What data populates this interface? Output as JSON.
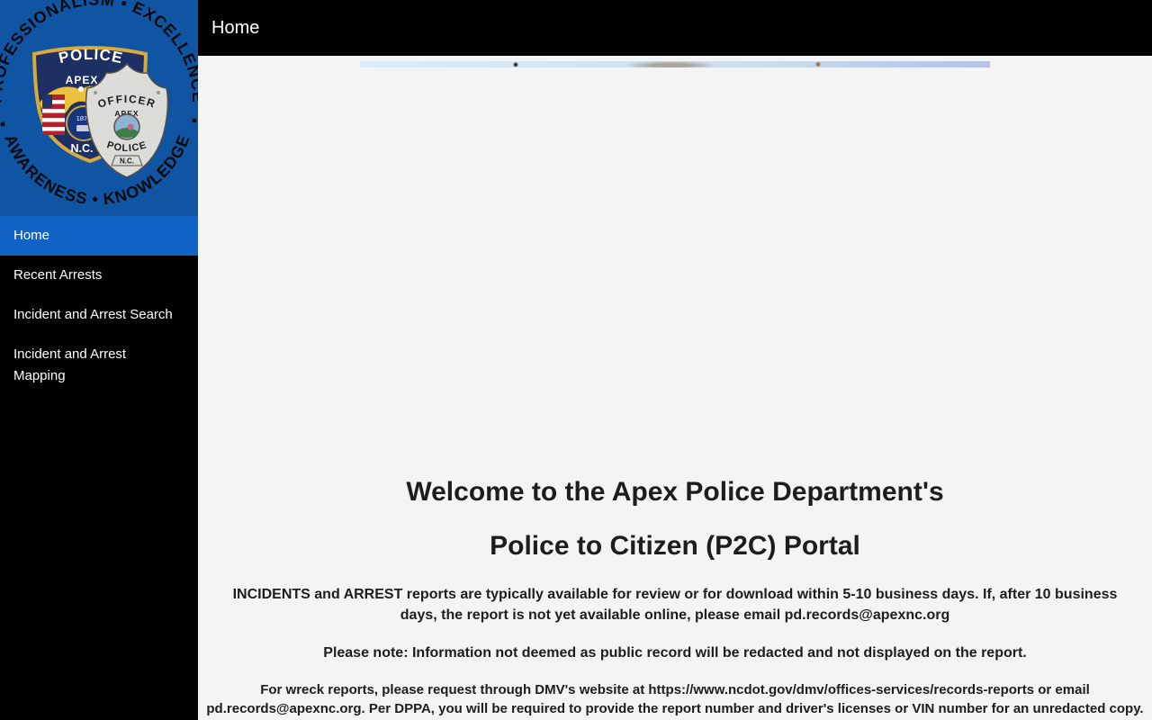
{
  "header": {
    "title": "Home"
  },
  "sidebar": {
    "logo": {
      "ring_top": "PROFESSIONALISM • EXCELLENCE",
      "ring_bottom": "AWARENESS • KNOWLEDGE",
      "patch_police": "POLICE",
      "patch_apex": "APEX",
      "patch_year": "1873",
      "patch_nc": "N.C.",
      "badge_officer": "OFFICER",
      "badge_apex": "APEX",
      "badge_police": "POLICE",
      "badge_nc": "N.C."
    },
    "items": [
      {
        "label": "Home",
        "active": true
      },
      {
        "label": "Recent Arrests",
        "active": false
      },
      {
        "label": "Incident and Arrest Search",
        "active": false
      },
      {
        "label": "Incident and Arrest Mapping",
        "active": false
      }
    ]
  },
  "main": {
    "heading1": "Welcome to the Apex Police Department's",
    "heading2": "Police to Citizen (P2C) Portal",
    "paragraphs": [
      "INCIDENTS and ARREST reports are typically available for review or for download within 5-10 business days. If, after 10 business days, the report is not yet available online, please email pd.records@apexnc.org",
      "Please note: Information not deemed as public record will be redacted and not displayed on the report.",
      "For wreck reports, please request through DMV's website at https://www.ncdot.gov/dmv/offices-services/records-reports or email pd.records@apexnc.org. Per DPPA, you will be required to provide the report number and driver's licenses or VIN number for an unredacted copy."
    ]
  },
  "colors": {
    "sidebar_background": "#000000",
    "logo_background": "#0f55a4",
    "active_item_background": "#1062c5",
    "topbar_background": "#000000",
    "content_background": "#f4f4f5",
    "nav_text": "#ffffff",
    "text_primary": "#1d1d1d"
  }
}
